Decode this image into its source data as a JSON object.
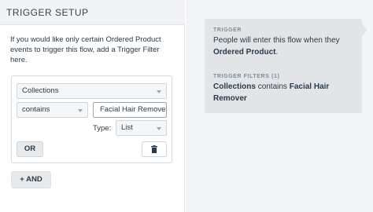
{
  "panel": {
    "title": "TRIGGER SETUP"
  },
  "intro": "If you would like only certain Ordered Product events to trigger this flow, add a Trigger Filter here.",
  "filter": {
    "property_select": "Collections",
    "operator_select": "contains",
    "value_input": "Facial Hair Remove",
    "type_label": "Type:",
    "type_select": "List",
    "or_button": "OR"
  },
  "and_button": "+ AND",
  "summary": {
    "trigger_label": "TRIGGER",
    "trigger_prefix": "People will enter this flow when they",
    "trigger_event": "Ordered Product",
    "trigger_suffix": ".",
    "filters_label": "TRIGGER FILTERS (1)",
    "filter_property": "Collections",
    "filter_operator": "contains",
    "filter_value": "Facial Hair Remover"
  },
  "icons": {
    "trash": "trash-icon",
    "chevron": "chevron-down-icon"
  },
  "colors": {
    "panel_header_bg": "#f1f3f4",
    "card_bg": "#e2e5e8",
    "right_bg": "#f3f4f5"
  }
}
